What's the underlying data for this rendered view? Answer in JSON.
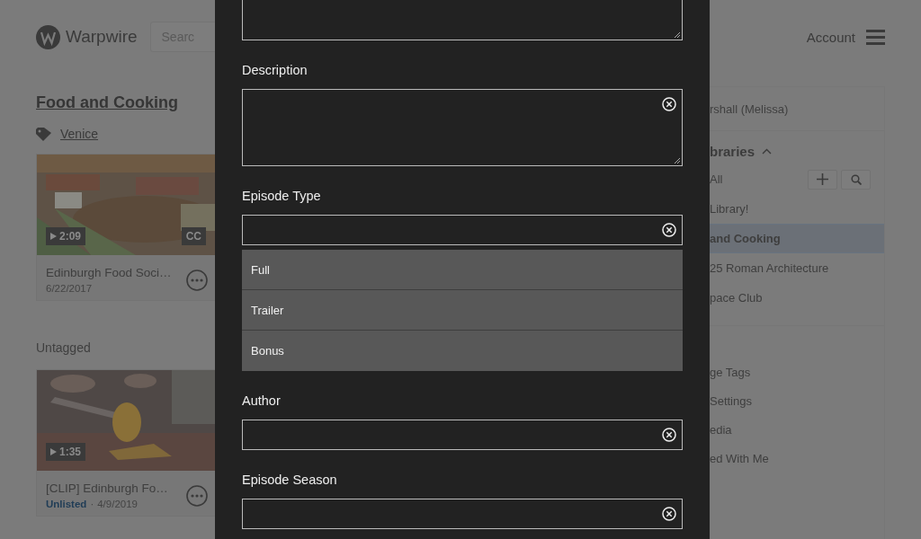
{
  "header": {
    "logo": "Warpwire",
    "search": {
      "placeholder": "Searc"
    },
    "account": "Account"
  },
  "library": {
    "title": "Food and Cooking",
    "tag": "Venice",
    "groups": [
      {
        "videos": [
          {
            "kind": "picture",
            "duration": "2:09",
            "captions": "CC",
            "title": "Edinburgh Food Soci…",
            "date": "6/22/2017"
          }
        ]
      },
      {
        "heading": "Untagged",
        "videos": [
          {
            "kind": "picture",
            "duration": "1:35",
            "title": "[CLIP] Edinburgh Fo…",
            "status": "Unlisted",
            "separator": "·",
            "date": "4/9/2019"
          }
        ]
      }
    ]
  },
  "sidebar": {
    "user": "rshall (Melissa)",
    "libraries_heading": "braries",
    "expanded": true,
    "libraries": [
      {
        "label": "All",
        "selected": false
      },
      {
        "label": "Library!",
        "selected": false
      },
      {
        "label": "and Cooking",
        "selected": true
      },
      {
        "label": "25 Roman Architecture",
        "selected": false
      },
      {
        "label": "pace Club",
        "selected": false
      }
    ],
    "links": [
      "ge Tags",
      "Settings",
      "edia",
      "ed With Me"
    ]
  },
  "modal": {
    "fields": [
      {
        "kind": "textarea",
        "clearable": false,
        "cut": true
      },
      {
        "label": "Description",
        "kind": "textarea",
        "clearable": true,
        "cut": false
      },
      {
        "label": "Episode Type",
        "kind": "select",
        "clearable": true,
        "cut": false,
        "options": [
          "Full",
          "Trailer",
          "Bonus"
        ]
      },
      {
        "label": "Author",
        "kind": "input",
        "clearable": true,
        "cut": false
      },
      {
        "label": "Episode Season",
        "kind": "input",
        "clearable": true,
        "cut": false
      }
    ]
  }
}
